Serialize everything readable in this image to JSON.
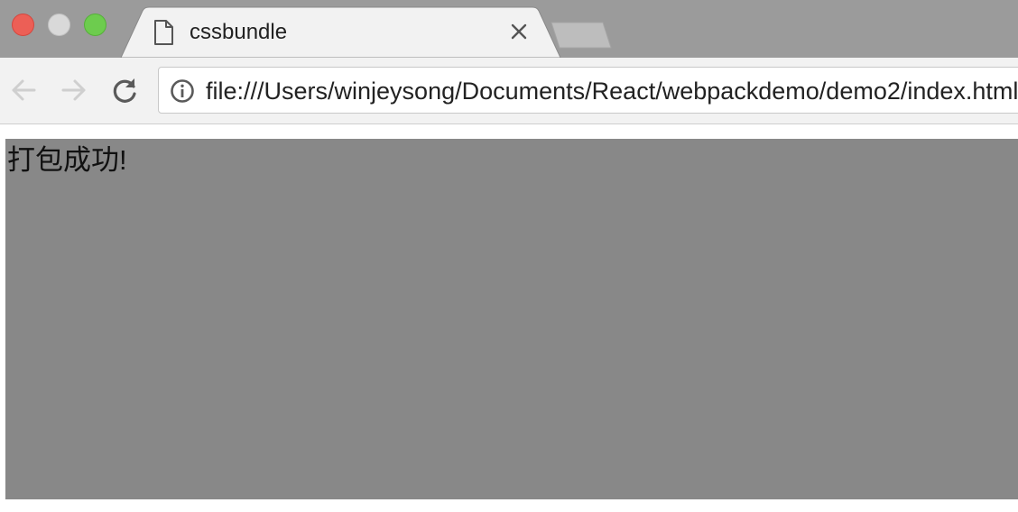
{
  "window": {
    "traffic_lights": [
      "close",
      "minimize",
      "zoom"
    ]
  },
  "tabs": [
    {
      "title": "cssbundle",
      "icon": "file-icon",
      "active": true
    },
    {
      "title": "",
      "icon": "",
      "active": false
    }
  ],
  "toolbar": {
    "back_icon": "arrow-left-icon",
    "forward_icon": "arrow-right-icon",
    "reload_icon": "reload-icon",
    "url": "file:///Users/winjeysong/Documents/React/webpackdemo/demo2/index.html",
    "security_icon": "info-icon"
  },
  "page": {
    "message": "打包成功!",
    "box_color": "#888888"
  },
  "colors": {
    "tabstrip": "#9b9b9b",
    "toolbar": "#f2f2f2",
    "traffic_close": "#ec5f56",
    "traffic_minimize": "#d9d9d9",
    "traffic_zoom": "#6dcc4e"
  }
}
